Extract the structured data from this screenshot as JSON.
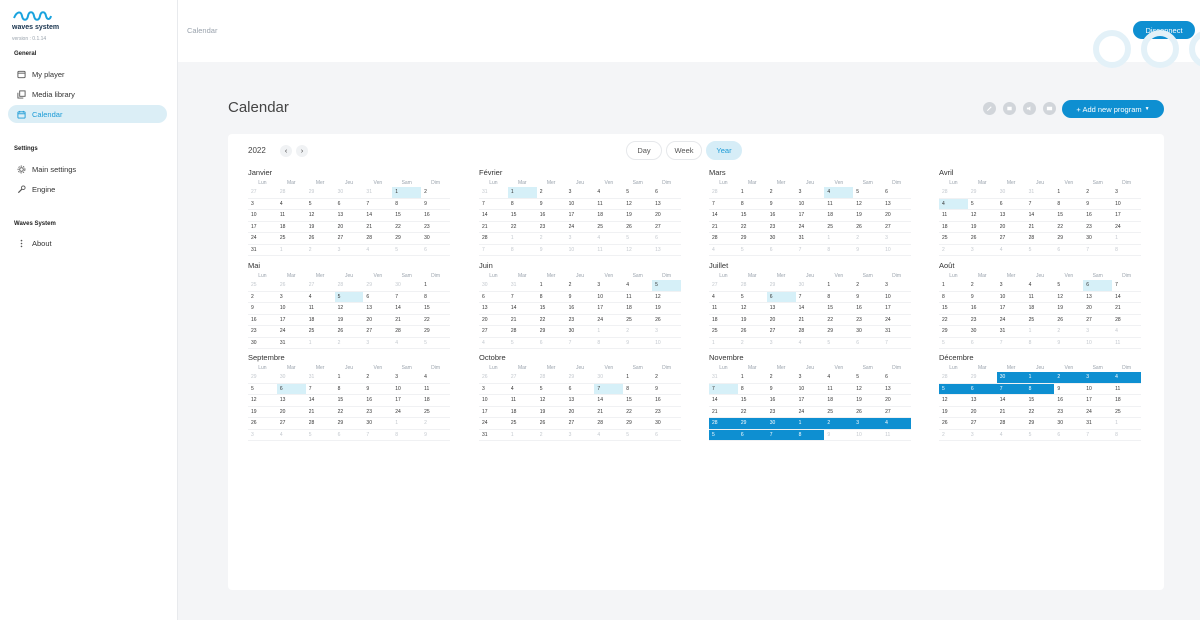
{
  "app": {
    "logo_text": "waves system",
    "version": "version : 0.1.14"
  },
  "sidebar": {
    "sections": [
      {
        "title": "General",
        "items": [
          {
            "label": "My player",
            "icon": "player-icon"
          },
          {
            "label": "Media library",
            "icon": "media-library-icon"
          },
          {
            "label": "Calendar",
            "icon": "calendar-icon",
            "active": true
          }
        ]
      },
      {
        "title": "Settings",
        "items": [
          {
            "label": "Main settings",
            "icon": "gear-icon"
          },
          {
            "label": "Engine",
            "icon": "wrench-icon"
          }
        ]
      },
      {
        "title": "Waves System",
        "items": [
          {
            "label": "About",
            "icon": "more-vertical-icon"
          }
        ]
      }
    ]
  },
  "topbar": {
    "breadcrumb": "Calendar",
    "disconnect_label": "Disconnect"
  },
  "main": {
    "title": "Calendar",
    "add_program_label": "+ Add new program",
    "toolbar_icons": [
      "edit-icon",
      "copy-icon",
      "volume-icon",
      "screen-icon"
    ]
  },
  "calendar": {
    "year": "2022",
    "view_tabs": [
      "Day",
      "Week",
      "Year"
    ],
    "active_view": "Year",
    "weekday_labels": [
      "Lun",
      "Mar",
      "Mer",
      "Jeu",
      "Ven",
      "Sam",
      "Dim"
    ],
    "months": [
      {
        "name": "Janvier",
        "first_weekday": 6,
        "days": 31,
        "prev_days": 31,
        "today": [
          1
        ]
      },
      {
        "name": "Février",
        "first_weekday": 2,
        "days": 28,
        "prev_days": 31,
        "today": [
          1
        ]
      },
      {
        "name": "Mars",
        "first_weekday": 2,
        "days": 31,
        "prev_days": 28,
        "today": [
          4
        ]
      },
      {
        "name": "Avril",
        "first_weekday": 5,
        "days": 30,
        "prev_days": 31,
        "today": [
          4
        ]
      },
      {
        "name": "Mai",
        "first_weekday": 7,
        "days": 31,
        "prev_days": 30,
        "today": [
          5
        ]
      },
      {
        "name": "Juin",
        "first_weekday": 3,
        "days": 30,
        "prev_days": 31,
        "today": [
          5
        ]
      },
      {
        "name": "Juillet",
        "first_weekday": 5,
        "days": 31,
        "prev_days": 30,
        "today": [
          6
        ]
      },
      {
        "name": "Août",
        "first_weekday": 1,
        "days": 31,
        "prev_days": 31,
        "today": [
          6
        ]
      },
      {
        "name": "Septembre",
        "first_weekday": 4,
        "days": 30,
        "prev_days": 31,
        "today": [
          6
        ]
      },
      {
        "name": "Octobre",
        "first_weekday": 6,
        "days": 31,
        "prev_days": 30,
        "today": [
          7
        ]
      },
      {
        "name": "Novembre",
        "first_weekday": 2,
        "days": 30,
        "prev_days": 31,
        "today": [
          7
        ],
        "events": [
          28,
          29,
          30
        ],
        "events_next": [
          1,
          2,
          3,
          4,
          5,
          6,
          7,
          8
        ]
      },
      {
        "name": "Décembre",
        "first_weekday": 4,
        "days": 31,
        "prev_days": 30,
        "today": [],
        "events": [
          1,
          2,
          3,
          4,
          5,
          6,
          7,
          8
        ],
        "events_prev": [
          30
        ]
      }
    ]
  },
  "colors": {
    "accent": "#0e8fd1",
    "today_highlight": "#d6f0f8",
    "active_nav": "#dbeef6"
  }
}
